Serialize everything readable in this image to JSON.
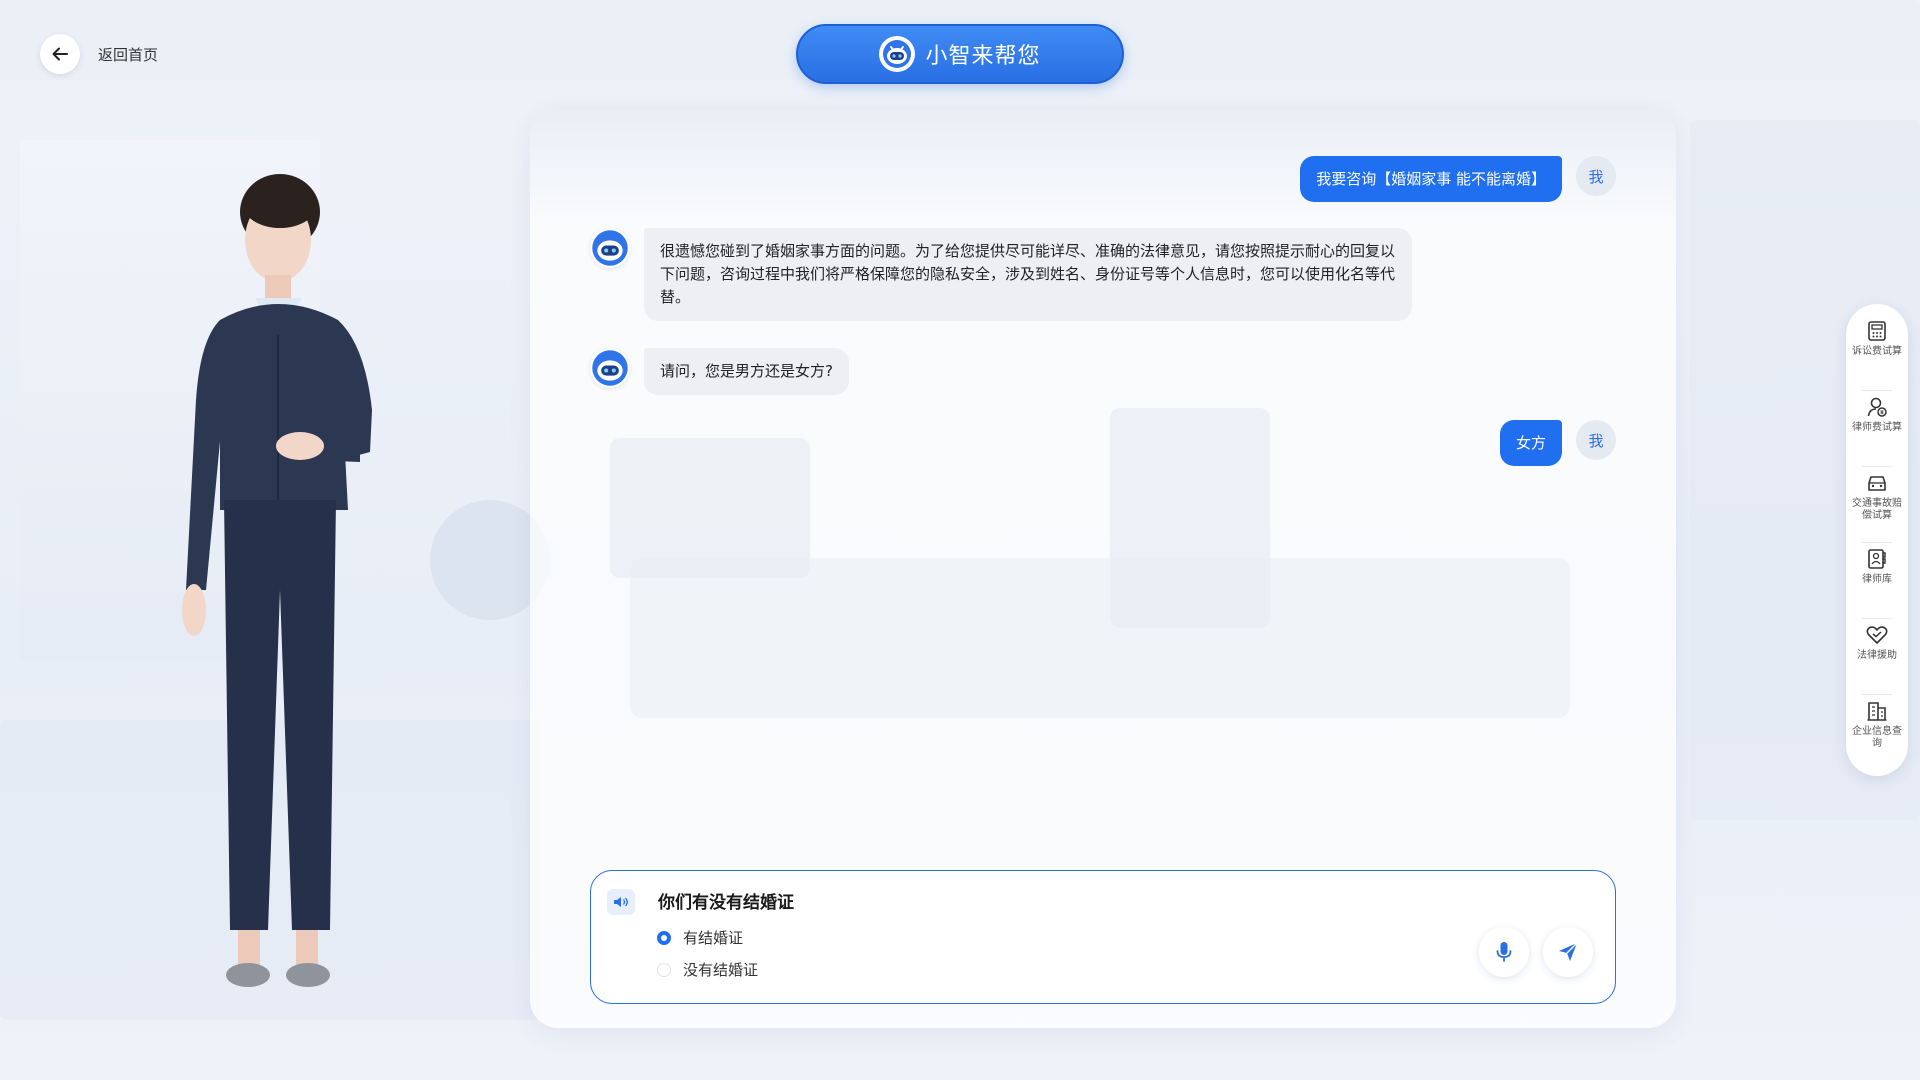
{
  "header": {
    "back_label": "返回首页",
    "title": "小智来帮您"
  },
  "chat": {
    "messages": [
      {
        "role": "user",
        "avatar": "我",
        "text": "我要咨询【婚姻家事 能不能离婚】"
      },
      {
        "role": "bot",
        "text": "很遗憾您碰到了婚姻家事方面的问题。为了给您提供尽可能详尽、准确的法律意见，请您按照提示耐心的回复以下问题，咨询过程中我们将严格保障您的隐私安全，涉及到姓名、身份证号等个人信息时，您可以使用化名等代替。"
      },
      {
        "role": "bot",
        "text": "请问，您是男方还是女方?"
      },
      {
        "role": "user",
        "avatar": "我",
        "text": "女方"
      }
    ]
  },
  "answer": {
    "question": "你们有没有结婚证",
    "options": [
      {
        "label": "有结婚证",
        "selected": true
      },
      {
        "label": "没有结婚证",
        "selected": false
      }
    ]
  },
  "toolbar": {
    "items": [
      {
        "icon": "calculator-icon",
        "label": "诉讼费试算"
      },
      {
        "icon": "lawyer-fee-icon",
        "label": "律师费试算"
      },
      {
        "icon": "car-icon",
        "label": "交通事故赔偿试算"
      },
      {
        "icon": "lawyer-book-icon",
        "label": "律师库"
      },
      {
        "icon": "heart-hand-icon",
        "label": "法律援助"
      },
      {
        "icon": "building-icon",
        "label": "企业信息查询"
      }
    ]
  },
  "colors": {
    "accent": "#1f6ff0",
    "bot_bubble": "#edeff3",
    "panel_bg": "#ffffff"
  }
}
